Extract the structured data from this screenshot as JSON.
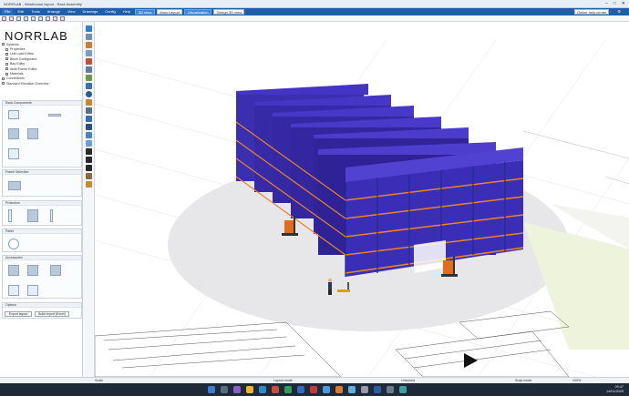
{
  "window": {
    "title": "NORRLAB - Warehouse layout - Rack Assembly",
    "controls": [
      "–",
      "□",
      "✕"
    ]
  },
  "menubar": {
    "items": [
      "File",
      "Edit",
      "Tools",
      "Arrange",
      "View",
      "Drawings",
      "Config",
      "Help"
    ],
    "view_button": "3D view",
    "layout_select": "Main Layout",
    "mode_button": "Visualization",
    "design_select": "Design 3D view",
    "right_user": "Online help center"
  },
  "left_panel": {
    "logo": "NORRLAB",
    "tree": [
      {
        "label": "Systems",
        "indent": false
      },
      {
        "label": "Properties",
        "indent": true
      },
      {
        "label": "Unit Load Editor",
        "indent": true
      },
      {
        "label": "Block Configurator",
        "indent": true
      },
      {
        "label": "Bay Editor",
        "indent": true
      },
      {
        "label": "Aisle Frame Editor",
        "indent": true
      },
      {
        "label": "Materials",
        "indent": true
      },
      {
        "label": "Connections",
        "indent": false
      },
      {
        "label": "Standard Elevation Overview",
        "indent": false
      }
    ],
    "sections": {
      "rack_components": "Rack Components",
      "frame_selection": "Frame Selection",
      "protection": "Protection",
      "pallet": "Pallet",
      "accessories": "Accessories",
      "options": "Options"
    },
    "buttons": {
      "export_layout": "Export layout",
      "build_report": "Build report (Excel)"
    }
  },
  "statusbar": {
    "scale": "Scale",
    "mode": "Layout mode",
    "unit": "Unlocked",
    "snap": "Snap mode",
    "zoom": "100%"
  },
  "taskbar": {
    "time": "09:47",
    "date": "14/01/2025"
  },
  "colors": {
    "menubar": "#1f5fa8",
    "rack_beam": "#e8832a",
    "rack_upright": "#2b3a9c",
    "pallet_load": "#3f2fb8",
    "forklift": "#e36b1c"
  }
}
